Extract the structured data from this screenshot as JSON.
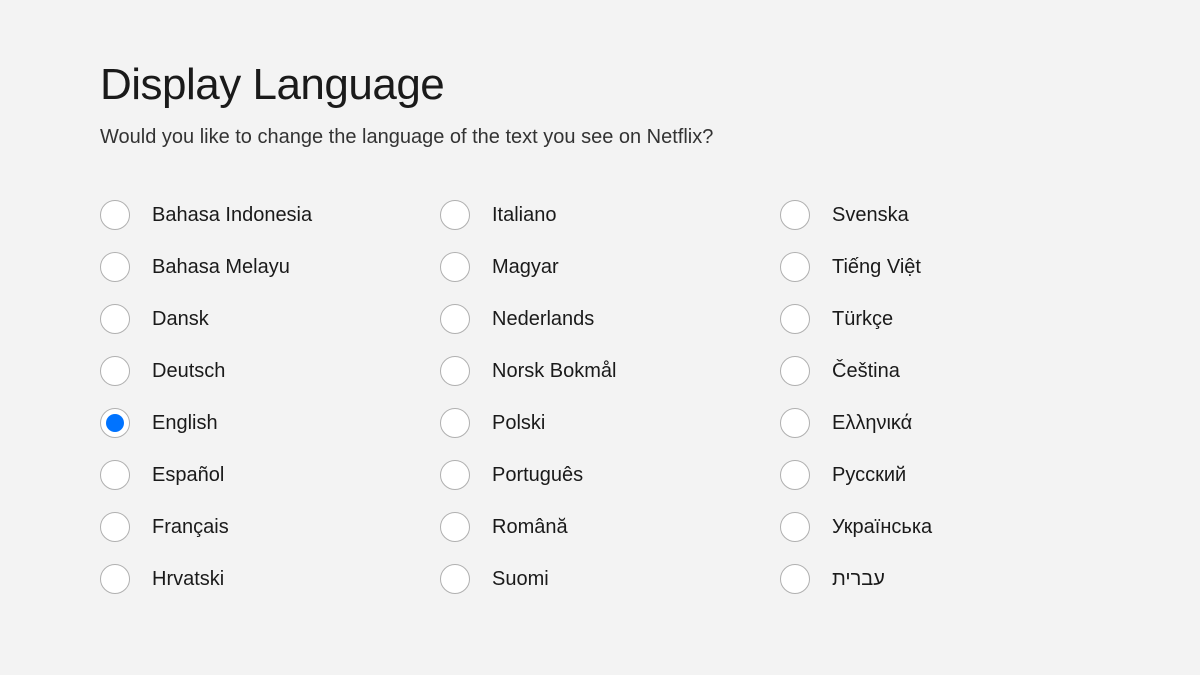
{
  "header": {
    "title": "Display Language",
    "subtitle": "Would you like to change the language of the text you see on Netflix?"
  },
  "languages": [
    {
      "label": "Bahasa Indonesia",
      "selected": false
    },
    {
      "label": "Italiano",
      "selected": false
    },
    {
      "label": "Svenska",
      "selected": false
    },
    {
      "label": "Bahasa Melayu",
      "selected": false
    },
    {
      "label": "Magyar",
      "selected": false
    },
    {
      "label": "Tiếng Việt",
      "selected": false
    },
    {
      "label": "Dansk",
      "selected": false
    },
    {
      "label": "Nederlands",
      "selected": false
    },
    {
      "label": "Türkçe",
      "selected": false
    },
    {
      "label": "Deutsch",
      "selected": false
    },
    {
      "label": "Norsk Bokmål",
      "selected": false
    },
    {
      "label": "Čeština",
      "selected": false
    },
    {
      "label": "English",
      "selected": true
    },
    {
      "label": "Polski",
      "selected": false
    },
    {
      "label": "Ελληνικά",
      "selected": false
    },
    {
      "label": "Español",
      "selected": false
    },
    {
      "label": "Português",
      "selected": false
    },
    {
      "label": "Русский",
      "selected": false
    },
    {
      "label": "Français",
      "selected": false
    },
    {
      "label": "Română",
      "selected": false
    },
    {
      "label": "Українська",
      "selected": false
    },
    {
      "label": "Hrvatski",
      "selected": false
    },
    {
      "label": "Suomi",
      "selected": false
    },
    {
      "label": "עברית",
      "selected": false
    }
  ]
}
